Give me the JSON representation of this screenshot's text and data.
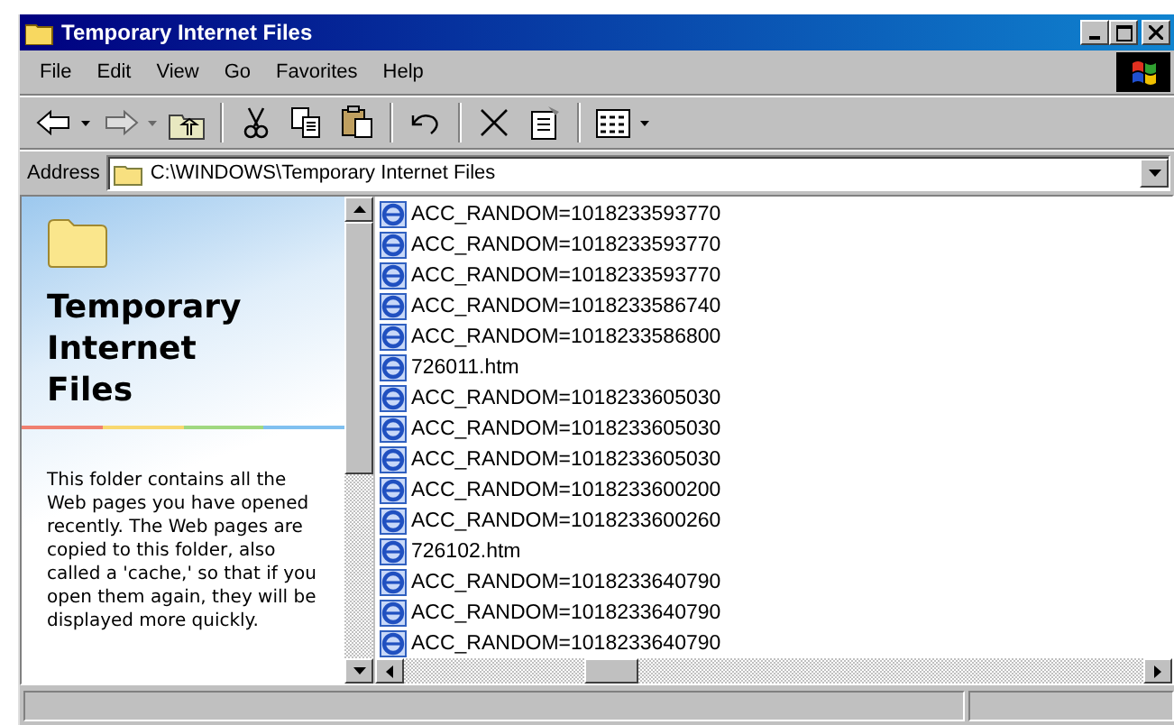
{
  "window": {
    "title": "Temporary Internet Files"
  },
  "menu": [
    {
      "label": "File"
    },
    {
      "label": "Edit"
    },
    {
      "label": "View"
    },
    {
      "label": "Go"
    },
    {
      "label": "Favorites"
    },
    {
      "label": "Help"
    }
  ],
  "toolbar": [
    [
      {
        "kind": "back",
        "dropdown": true,
        "disabled": false
      },
      {
        "kind": "forward",
        "dropdown": true,
        "disabled": true
      },
      {
        "kind": "up",
        "dropdown": false,
        "disabled": false
      }
    ],
    [
      {
        "kind": "cut",
        "dropdown": false,
        "disabled": false
      },
      {
        "kind": "copy",
        "dropdown": false,
        "disabled": false
      },
      {
        "kind": "paste",
        "dropdown": false,
        "disabled": false
      }
    ],
    [
      {
        "kind": "undo",
        "dropdown": false,
        "disabled": false
      }
    ],
    [
      {
        "kind": "delete",
        "dropdown": false,
        "disabled": false
      },
      {
        "kind": "properties",
        "dropdown": false,
        "disabled": false
      }
    ],
    [
      {
        "kind": "views",
        "dropdown": true,
        "disabled": false
      }
    ]
  ],
  "address": {
    "label": "Address",
    "value": "C:\\WINDOWS\\Temporary Internet Files"
  },
  "info_pane": {
    "title": "Temporary Internet Files",
    "description": "This folder contains all the Web pages you have opened recently. The Web pages are copied to this folder, also called a 'cache,' so that if you open them again, they will be displayed more quickly."
  },
  "files": [
    {
      "name": "ACC_RANDOM=1018233593770"
    },
    {
      "name": "ACC_RANDOM=1018233593770"
    },
    {
      "name": "ACC_RANDOM=1018233593770"
    },
    {
      "name": "ACC_RANDOM=1018233586740"
    },
    {
      "name": "ACC_RANDOM=1018233586800"
    },
    {
      "name": "726011.htm"
    },
    {
      "name": "ACC_RANDOM=1018233605030"
    },
    {
      "name": "ACC_RANDOM=1018233605030"
    },
    {
      "name": "ACC_RANDOM=1018233605030"
    },
    {
      "name": "ACC_RANDOM=1018233600200"
    },
    {
      "name": "ACC_RANDOM=1018233600260"
    },
    {
      "name": "726102.htm"
    },
    {
      "name": "ACC_RANDOM=1018233640790"
    },
    {
      "name": "ACC_RANDOM=1018233640790"
    },
    {
      "name": "ACC_RANDOM=1018233640790"
    }
  ]
}
